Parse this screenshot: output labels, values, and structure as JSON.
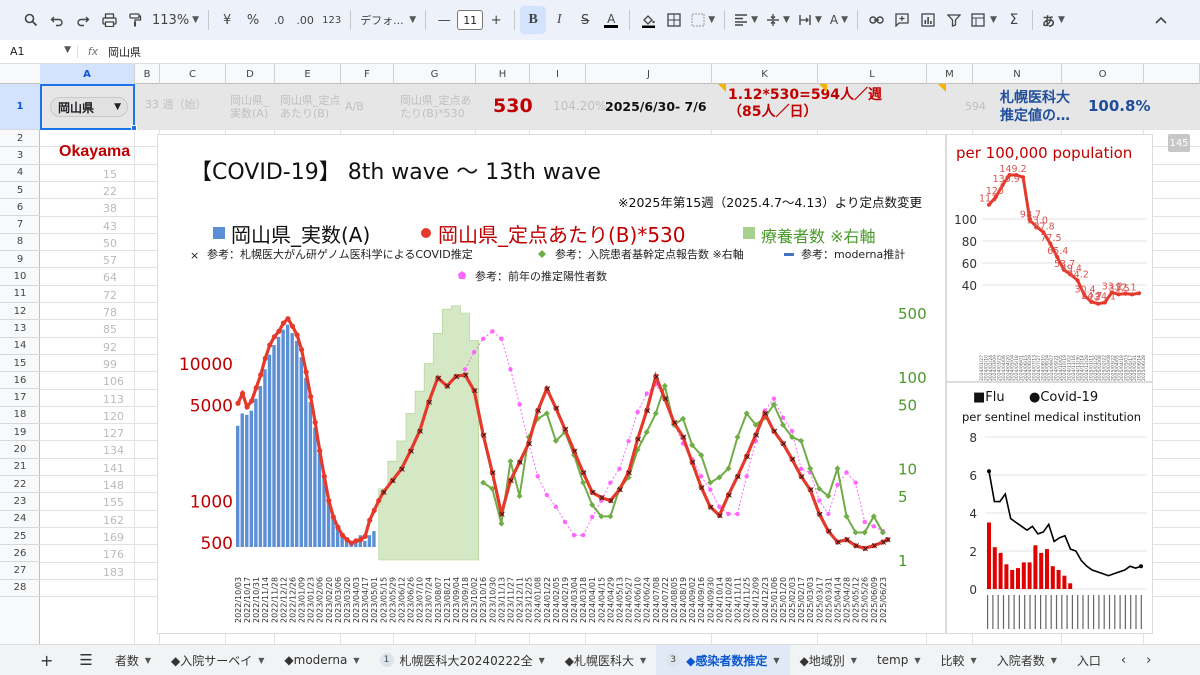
{
  "toolbar": {
    "zoom": "113%",
    "currency": "¥",
    "percent": "%",
    "dec_decrease": ".0",
    "dec_increase": ".00",
    "number_format": "123",
    "font": "デフォ...",
    "font_size": "11",
    "input_method": "あ",
    "sum": "Σ"
  },
  "formula_bar": {
    "cell_ref": "A1",
    "content": "岡山県"
  },
  "columns": [
    "A",
    "B",
    "C",
    "D",
    "E",
    "F",
    "G",
    "H",
    "I",
    "J",
    "K",
    "L",
    "M",
    "N",
    "O"
  ],
  "rows": [
    "1",
    "2",
    "3",
    "4",
    "5",
    "6",
    "7",
    "8",
    "9",
    "10",
    "11",
    "12",
    "13",
    "14",
    "15",
    "16",
    "17",
    "18",
    "19",
    "20",
    "21",
    "22",
    "23",
    "24",
    "25",
    "26",
    "27",
    "28"
  ],
  "row1": {
    "a1": "岡山県",
    "b1": "33 週（始）",
    "d1_line1": "岡山県_",
    "d1_line2": "実数(A)",
    "e1_line1": "岡山県_定点",
    "e1_line2": "あたり(B)",
    "f1": "A/B",
    "g1_line1": "岡山県_定点あ",
    "g1_line2": "たり(B)*530",
    "h1": "530",
    "i1": "104.20%",
    "j1": "2025/6/30- 7/6",
    "k1_line1": "1.12*530=594人／週",
    "k1_line2": "（85人／日）",
    "m1": "594",
    "n1_line1": "札幌医科大",
    "n1_line2": "推定値の…",
    "o1": "100.8%"
  },
  "col_c_values": [
    "15",
    "22",
    "38",
    "43",
    "50",
    "57",
    "64",
    "72",
    "78",
    "85",
    "92",
    "99",
    "106",
    "113",
    "120",
    "127",
    "134",
    "141",
    "148",
    "155",
    "162",
    "169",
    "176",
    "183"
  ],
  "okayama_label": "Okayama",
  "scroll_badge": "145",
  "main_chart": {
    "title": "【COVID-19】 8th wave 〜 13th wave",
    "note": "※2025年第15週（2025.4.7〜4.13）より定点数変更",
    "legend_big": [
      {
        "name": "岡山県_実数(A)",
        "color": "#5b8fd6",
        "marker": "square"
      },
      {
        "name": "岡山県_定点あたり(B)*530",
        "color": "#e53a2b",
        "marker": "circle"
      },
      {
        "name": "療養者数 ※右軸",
        "color": "#a9d18e",
        "marker": "square"
      }
    ],
    "legend_small": [
      {
        "name": "参考：札幌医大がん研ゲノム医科学によるCOVID推定",
        "color": "#222222",
        "marker": "x"
      },
      {
        "name": "参考：入院患者基幹定点報告数 ※右軸",
        "color": "#70ad47",
        "marker": "diamond"
      },
      {
        "name": "参考：moderna推計",
        "color": "#4472c4",
        "marker": "line"
      },
      {
        "name": "参考：前年の推定陽性者数",
        "color": "#ff66ff",
        "marker": "pentagon"
      }
    ]
  },
  "chart_data": [
    {
      "type": "line",
      "title": "【COVID-19】 8th wave 〜 13th wave",
      "x_ticks": [
        "2022/10/03",
        "2022/10/17",
        "2022/10/31",
        "2022/11/14",
        "2022/11/28",
        "2022/12/12",
        "2022/12/26",
        "2023/01/09",
        "2023/01/23",
        "2023/02/06",
        "2023/02/20",
        "2023/03/06",
        "2023/03/20",
        "2023/04/03",
        "2023/04/17",
        "2023/05/01",
        "2023/05/15",
        "2023/05/29",
        "2023/06/12",
        "2023/06/26",
        "2023/07/10",
        "2023/07/24",
        "2023/08/07",
        "2023/08/21",
        "2023/09/04",
        "2023/09/18",
        "2023/10/02",
        "2023/10/16",
        "2023/10/30",
        "2023/11/13",
        "2023/11/27",
        "2023/12/11",
        "2023/12/25",
        "2024/01/08",
        "2024/01/22",
        "2024/02/05",
        "2024/02/19",
        "2024/03/04",
        "2024/03/18",
        "2024/04/01",
        "2024/04/15",
        "2024/04/29",
        "2024/05/13",
        "2024/05/27",
        "2024/06/10",
        "2024/06/24",
        "2024/07/08",
        "2024/07/22",
        "2024/08/05",
        "2024/08/19",
        "2024/09/02",
        "2024/09/16",
        "2024/09/30",
        "2024/10/14",
        "2024/10/28",
        "2024/11/11",
        "2024/11/25",
        "2024/12/09",
        "2024/12/23",
        "2025/01/06",
        "2025/01/20",
        "2025/02/03",
        "2025/02/17",
        "2025/03/03",
        "2025/03/17",
        "2025/03/31",
        "2025/04/14",
        "2025/04/28",
        "2025/05/12",
        "2025/05/26",
        "2025/06/09",
        "2025/06/23"
      ],
      "y_left_ticks": [
        "500",
        "1000",
        "5000",
        "10000"
      ],
      "y_left_scale": "log",
      "y_right_ticks": [
        "1",
        "5",
        "10",
        "50",
        "100",
        "500"
      ],
      "y_right_scale": "log",
      "x_range": [
        "2022/10/03",
        "2025/07/04"
      ],
      "series": [
        {
          "name": "岡山県_実数(A)",
          "kind": "bar",
          "x": [
            "2022/10/03",
            "2022/10/10",
            "2022/10/17",
            "2022/10/24",
            "2022/10/31",
            "2022/11/07",
            "2022/11/14",
            "2022/11/21",
            "2022/11/28",
            "2022/12/05",
            "2022/12/12",
            "2022/12/19",
            "2022/12/26",
            "2023/01/02",
            "2023/01/09",
            "2023/01/16",
            "2023/01/23",
            "2023/01/30",
            "2023/02/06",
            "2023/02/13",
            "2023/02/20",
            "2023/02/27",
            "2023/03/06",
            "2023/03/13",
            "2023/03/20",
            "2023/03/27",
            "2023/04/03",
            "2023/04/10",
            "2023/04/17",
            "2023/04/24",
            "2023/05/01"
          ],
          "values": [
            3500,
            4300,
            4200,
            4500,
            5500,
            6800,
            9000,
            11500,
            13500,
            15500,
            17500,
            19000,
            16500,
            14500,
            11000,
            7800,
            5200,
            3400,
            2200,
            1450,
            1000,
            780,
            650,
            560,
            520,
            500,
            520,
            560,
            510,
            560,
            600
          ]
        },
        {
          "name": "岡山県_定点あたり(B)*530",
          "kind": "line",
          "x": [
            "2022/10/03",
            "2022/10/10",
            "2022/10/17",
            "2022/10/24",
            "2022/10/31",
            "2022/11/07",
            "2022/11/14",
            "2022/11/21",
            "2022/11/28",
            "2022/12/05",
            "2022/12/12",
            "2022/12/19",
            "2022/12/26",
            "2023/01/02",
            "2023/01/09",
            "2023/01/16",
            "2023/01/23",
            "2023/01/30",
            "2023/02/06",
            "2023/02/13",
            "2023/02/20",
            "2023/02/27",
            "2023/03/06",
            "2023/03/13",
            "2023/03/20",
            "2023/03/27",
            "2023/04/03",
            "2023/04/10",
            "2023/04/17",
            "2023/04/24",
            "2023/05/01",
            "2023/05/08",
            "2023/05/15",
            "2023/05/29",
            "2023/06/12",
            "2023/06/26",
            "2023/07/10",
            "2023/07/24",
            "2023/08/07",
            "2023/08/21",
            "2023/09/04",
            "2023/09/18",
            "2023/10/02",
            "2023/10/16",
            "2023/10/30",
            "2023/11/13",
            "2023/11/27",
            "2023/12/11",
            "2023/12/25",
            "2024/01/08",
            "2024/01/22",
            "2024/02/05",
            "2024/02/19",
            "2024/03/04",
            "2024/03/18",
            "2024/04/01",
            "2024/04/15",
            "2024/04/29",
            "2024/05/13",
            "2024/05/27",
            "2024/06/10",
            "2024/06/24",
            "2024/07/08",
            "2024/07/22",
            "2024/08/05",
            "2024/08/19",
            "2024/09/02",
            "2024/09/16",
            "2024/09/30",
            "2024/10/14",
            "2024/10/28",
            "2024/11/11",
            "2024/11/25",
            "2024/12/09",
            "2024/12/23",
            "2025/01/06",
            "2025/01/20",
            "2025/02/03",
            "2025/02/17",
            "2025/03/03",
            "2025/03/17",
            "2025/03/31",
            "2025/04/14",
            "2025/04/28",
            "2025/05/12",
            "2025/05/26",
            "2025/06/09",
            "2025/06/23",
            "2025/06/30"
          ],
          "values": [
            5100,
            6000,
            4800,
            5300,
            6600,
            8200,
            10800,
            13500,
            15500,
            17000,
            19500,
            21000,
            18500,
            16000,
            12500,
            8600,
            5700,
            3700,
            2300,
            1500,
            1000,
            760,
            640,
            560,
            520,
            490,
            510,
            520,
            550,
            720,
            850,
            1000,
            1150,
            1400,
            1700,
            2300,
            3200,
            5200,
            7800,
            6800,
            8000,
            8200,
            6300,
            3000,
            1600,
            800,
            1400,
            1900,
            2600,
            4500,
            6500,
            4700,
            3300,
            2300,
            1600,
            1150,
            1050,
            1000,
            1200,
            1600,
            2800,
            4500,
            8000,
            5500,
            3700,
            2900,
            1900,
            1250,
            900,
            780,
            1100,
            1500,
            2100,
            3000,
            4300,
            3200,
            2600,
            2000,
            1500,
            1200,
            800,
            600,
            500,
            520,
            470,
            450,
            470,
            500,
            520
          ]
        },
        {
          "name": "参考：入院患者基幹定点報告数 ※右軸",
          "kind": "line",
          "x": [
            "2023/10/16",
            "2023/10/30",
            "2023/11/13",
            "2023/11/27",
            "2023/12/11",
            "2023/12/25",
            "2024/01/08",
            "2024/01/22",
            "2024/02/05",
            "2024/02/19",
            "2024/03/04",
            "2024/03/18",
            "2024/04/01",
            "2024/04/15",
            "2024/04/29",
            "2024/05/13",
            "2024/05/27",
            "2024/06/10",
            "2024/06/24",
            "2024/07/08",
            "2024/07/22",
            "2024/08/05",
            "2024/08/19",
            "2024/09/02",
            "2024/09/16",
            "2024/09/30",
            "2024/10/14",
            "2024/10/28",
            "2024/11/11",
            "2024/11/25",
            "2024/12/09",
            "2024/12/23",
            "2025/01/06",
            "2025/01/20",
            "2025/02/03",
            "2025/02/17",
            "2025/03/03",
            "2025/03/17",
            "2025/03/31",
            "2025/04/14",
            "2025/04/28",
            "2025/05/12",
            "2025/05/26",
            "2025/06/09",
            "2025/06/23"
          ],
          "values": [
            7,
            6,
            2.5,
            12,
            5,
            22,
            35,
            40,
            20,
            25,
            14,
            7,
            4,
            3,
            3,
            6,
            8,
            16,
            25,
            40,
            80,
            30,
            35,
            18,
            14,
            7,
            8,
            10,
            22,
            40,
            30,
            36,
            50,
            30,
            22,
            20,
            10,
            6,
            5,
            10,
            3,
            2,
            2,
            3,
            2
          ]
        },
        {
          "name": "療養者数 ※右軸",
          "kind": "area",
          "x": [
            "2023/05/08",
            "2023/05/22",
            "2023/06/05",
            "2023/06/19",
            "2023/07/03",
            "2023/07/17",
            "2023/07/31",
            "2023/08/14",
            "2023/08/28",
            "2023/09/11",
            "2023/09/25"
          ],
          "values": [
            6,
            12,
            20,
            40,
            70,
            140,
            300,
            550,
            600,
            500,
            250
          ]
        },
        {
          "name": "参考：前年の推定陽性者数",
          "kind": "line",
          "x": [
            "2023/09/18",
            "2023/10/02",
            "2023/10/16",
            "2023/10/30",
            "2023/11/13",
            "2023/11/27",
            "2023/12/11",
            "2023/12/25",
            "2024/01/08",
            "2024/01/22",
            "2024/02/05",
            "2024/02/19",
            "2024/03/04",
            "2024/03/18",
            "2024/04/01",
            "2024/04/15",
            "2024/04/29",
            "2024/05/13",
            "2024/05/27",
            "2024/06/10",
            "2024/06/24",
            "2024/07/08",
            "2024/07/22",
            "2024/08/05",
            "2024/08/19",
            "2024/09/02",
            "2024/09/16",
            "2024/09/30",
            "2024/10/14",
            "2024/10/28",
            "2024/11/11",
            "2024/11/25",
            "2024/12/09",
            "2024/12/23",
            "2025/01/06",
            "2025/01/20",
            "2025/02/03",
            "2025/02/17",
            "2025/03/03",
            "2025/03/17",
            "2025/03/31",
            "2025/04/14",
            "2025/04/28",
            "2025/05/12",
            "2025/05/26",
            "2025/06/09",
            "2025/06/23"
          ],
          "values": [
            9000,
            12000,
            15000,
            17000,
            15000,
            9000,
            5000,
            2600,
            1500,
            1100,
            900,
            700,
            560,
            560,
            760,
            1000,
            1350,
            1700,
            2700,
            4400,
            6000,
            7000,
            5500,
            3600,
            2600,
            2000,
            1500,
            1200,
            900,
            800,
            800,
            1500,
            2700,
            4500,
            5500,
            4000,
            3200,
            1700,
            1600,
            1000,
            800,
            1300,
            1600,
            1350,
            700,
            650,
            600
          ]
        }
      ]
    },
    {
      "type": "line",
      "title": "per 100,000 population",
      "y_ticks": [
        "40",
        "60",
        "80",
        "100"
      ],
      "x_ticks": [
        "2024/01/27",
        "2024/02/10",
        "2024/02/24",
        "2024/03/09",
        "2024/03/23",
        "2024/04/06",
        "2024/04/20",
        "2024/05/04",
        "2024/05/18",
        "2024/06/01",
        "2024/06/15",
        "2024/06/29",
        "2024/07/13",
        "2024/07/27",
        "2024/08/10",
        "2024/08/24",
        "2024/09/07",
        "2024/09/21",
        "2024/10/05",
        "2024/10/19",
        "2024/11/02",
        "2024/11/16",
        "2024/11/30",
        "2024/12/14",
        "2024/12/28",
        "2025/01/11",
        "2025/01/25",
        "2025/02/08",
        "2025/02/22",
        "2025/03/08",
        "2025/03/22",
        "2025/04/05",
        "2025/04/19",
        "2025/05/03",
        "2025/05/17",
        "2025/05/31",
        "2025/06/14",
        "2025/06/28"
      ],
      "series": [
        {
          "name": "",
          "values": [
            113,
            120,
            130.9,
            149.2,
            150,
            138,
            98.7,
            93.0,
            87.8,
            77.5,
            65.4,
            53.7,
            49.4,
            44.2,
            30.4,
            24.7,
            23,
            24.1,
            33.2,
            31.5,
            32.1,
            31.5,
            32.5
          ],
          "labels": [
            "113",
            "120",
            "130.9",
            "149.2",
            "",
            "",
            "98.7",
            "93.0",
            "87.8",
            "77.5",
            "65.4",
            "53.7",
            "49.4",
            "44.2",
            "30.4",
            "24.7",
            "23",
            "24.1",
            "33.2",
            "31.5",
            "32.1",
            "",
            ""
          ]
        }
      ]
    },
    {
      "type": "bar",
      "title": "per sentinel medical institution",
      "legend": [
        "■Flu",
        "●Covid-19"
      ],
      "ylim": [
        0,
        8
      ],
      "y_ticks": [
        "0",
        "2",
        "4",
        "6",
        "8"
      ],
      "series": [
        {
          "name": "■Flu",
          "kind": "bar",
          "color": "#e00000",
          "values": [
            3.5,
            2.2,
            1.9,
            1.3,
            1.0,
            1.1,
            1.4,
            1.4,
            2.3,
            1.9,
            2.1,
            1.2,
            1.0,
            0.7,
            0.3
          ]
        },
        {
          "name": "●Covid-19",
          "kind": "line",
          "color": "#000000",
          "values": [
            6.2,
            4.6,
            4.6,
            5.0,
            3.7,
            3.5,
            3.3,
            3.1,
            3.3,
            2.9,
            3.0,
            3.4,
            2.5,
            2.7,
            2.8,
            2.1,
            2.0,
            1.5,
            1.2,
            1.0,
            0.9,
            0.8,
            0.7,
            0.8,
            0.9,
            1.0,
            1.2,
            1.1,
            1.2
          ]
        }
      ]
    }
  ],
  "tabs": [
    {
      "label": "者数",
      "num": "",
      "active": false
    },
    {
      "label": "◆入院サーベイ",
      "num": "",
      "active": false
    },
    {
      "label": "◆moderna",
      "num": "",
      "active": false
    },
    {
      "label": "札幌医科大20240222全",
      "num": "1",
      "active": false
    },
    {
      "label": "◆札幌医科大",
      "num": "",
      "active": false
    },
    {
      "label": "◆感染者数推定",
      "num": "3",
      "active": true
    },
    {
      "label": "◆地域別",
      "num": "",
      "active": false
    },
    {
      "label": "temp",
      "num": "",
      "active": false
    },
    {
      "label": "比較",
      "num": "",
      "active": false
    },
    {
      "label": "入院者数",
      "num": "",
      "active": false
    },
    {
      "label": "入口",
      "num": "",
      "active": false
    }
  ],
  "colors": {
    "accent": "#0b57d0",
    "toolbar_bg": "#edf2fa",
    "header_red": "#c00000",
    "header_blue": "#1f4e9c"
  }
}
